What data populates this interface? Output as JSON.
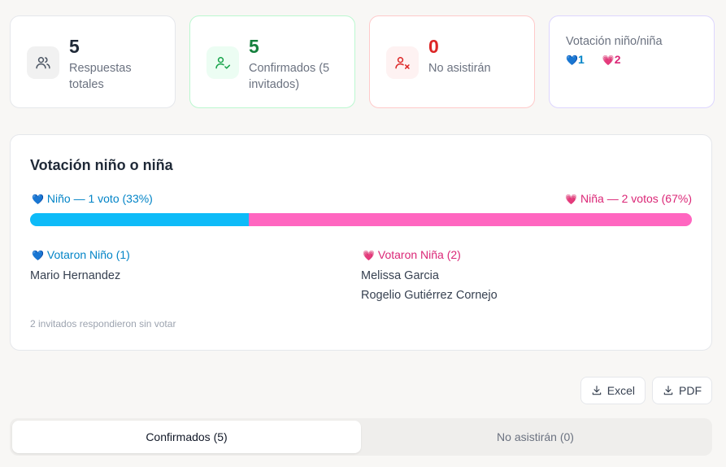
{
  "stats": [
    {
      "value": "5",
      "label_line1": "Respuestas",
      "label_line2": "totales",
      "icon": "users-icon"
    },
    {
      "value": "5",
      "label_line1": "Confirmados (5",
      "label_line2": "invitados)",
      "icon": "user-check-icon"
    },
    {
      "value": "0",
      "label_line1": "No asistirán",
      "label_line2": "",
      "icon": "user-x-icon"
    }
  ],
  "vote_card": {
    "title": "Votación niño/niña",
    "boy_count": "1",
    "girl_count": "2"
  },
  "panel": {
    "title": "Votación niño o niña",
    "boy_label": "Niño — 1 voto (33%)",
    "girl_label": "Niña — 2 votos (67%)",
    "boy_fraction": 0.33,
    "girl_fraction": 0.67,
    "boy_heading": "Votaron Niño (1)",
    "girl_heading": "Votaron Niña (2)",
    "boy_voters": [
      "Mario Hernandez"
    ],
    "girl_voters": [
      "Melissa Garcia",
      "Rogelio Gutiérrez Cornejo"
    ],
    "note": "2 invitados respondieron sin votar"
  },
  "export": {
    "excel_label": "Excel",
    "pdf_label": "PDF"
  },
  "tabs": [
    {
      "label": "Confirmados (5)",
      "active": true
    },
    {
      "label": "No asistirán (0)",
      "active": false
    }
  ],
  "colors": {
    "boy": "#0ebbf8",
    "girl": "#ff66c0"
  }
}
